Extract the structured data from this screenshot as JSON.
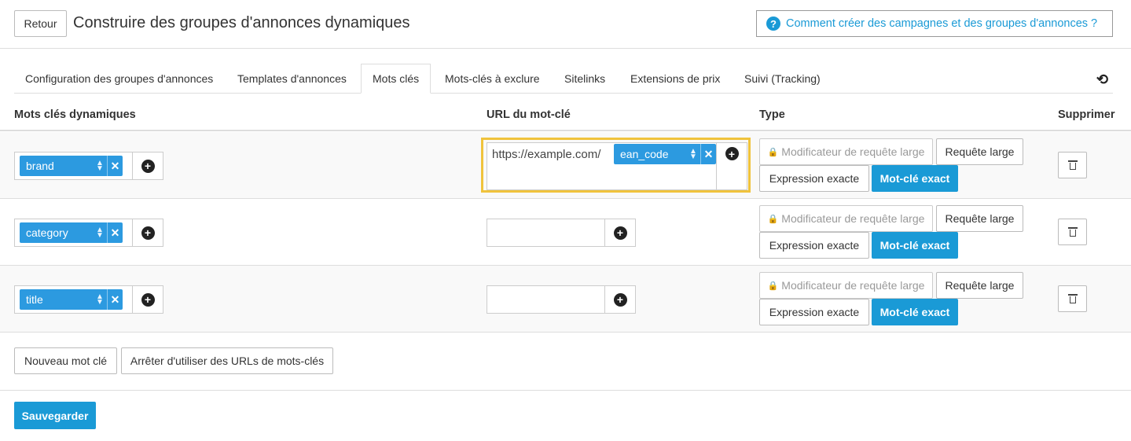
{
  "header": {
    "back_label": "Retour",
    "title": "Construire des groupes d'annonces dynamiques",
    "help_icon": "?",
    "help_label": "Comment créer des campagnes et des groupes d'annonces ?"
  },
  "tabs": [
    {
      "label": "Configuration des groupes d'annonces",
      "active": false
    },
    {
      "label": "Templates d'annonces",
      "active": false
    },
    {
      "label": "Mots clés",
      "active": true
    },
    {
      "label": "Mots-clés à exclure",
      "active": false
    },
    {
      "label": "Sitelinks",
      "active": false
    },
    {
      "label": "Extensions de prix",
      "active": false
    },
    {
      "label": "Suivi (Tracking)",
      "active": false
    }
  ],
  "table": {
    "headers": {
      "keywords": "Mots clés dynamiques",
      "url": "URL du mot-clé",
      "type": "Type",
      "delete": "Supprimer"
    },
    "rows": [
      {
        "keyword": "brand",
        "url_text": "https://example.com/",
        "url_tag": "ean_code"
      },
      {
        "keyword": "category",
        "url_text": "",
        "url_tag": ""
      },
      {
        "keyword": "title",
        "url_text": "",
        "url_tag": ""
      }
    ],
    "type_options": {
      "modifier": "Modificateur de requête large",
      "broad": "Requête large",
      "phrase": "Expression exacte",
      "exact": "Mot-clé exact"
    }
  },
  "footer": {
    "new_keyword": "Nouveau mot clé",
    "stop_urls": "Arrêter d'utiliser des URLs de mots-clés",
    "save": "Sauvegarder"
  },
  "colors": {
    "accent": "#1a9ad6",
    "tag": "#2c9ae0",
    "highlight": "#f0c33c"
  }
}
